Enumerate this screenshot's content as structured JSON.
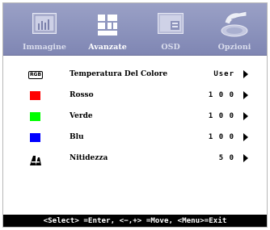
{
  "tabs": [
    {
      "label": "Immagine",
      "icon": "picture-icon",
      "active": false
    },
    {
      "label": "Avanzate",
      "icon": "advanced-grid-icon",
      "active": true
    },
    {
      "label": "OSD",
      "icon": "osd-window-icon",
      "active": false
    },
    {
      "label": "Opzioni",
      "icon": "options-hand-icon",
      "active": false
    }
  ],
  "items": [
    {
      "label": "Temperatura Del Colore",
      "value": "User",
      "icon": "rgb-icon"
    },
    {
      "label": "Rosso",
      "value": "1 0 0",
      "icon": "red-square-icon",
      "color": "#ff0000"
    },
    {
      "label": "Verde",
      "value": "1 0 0",
      "icon": "green-square-icon",
      "color": "#00ff00"
    },
    {
      "label": "Blu",
      "value": "1 0 0",
      "icon": "blue-square-icon",
      "color": "#0000ff"
    },
    {
      "label": "Nitidezza",
      "value": "5 0",
      "icon": "sharpness-icon"
    }
  ],
  "rgb_icon_text": "RGB",
  "footer": "<Select> =Enter, <−,+> =Move, <Menu>=Exit",
  "colors": {
    "tabbar": "#8e95be",
    "footer_bg": "#000000"
  }
}
